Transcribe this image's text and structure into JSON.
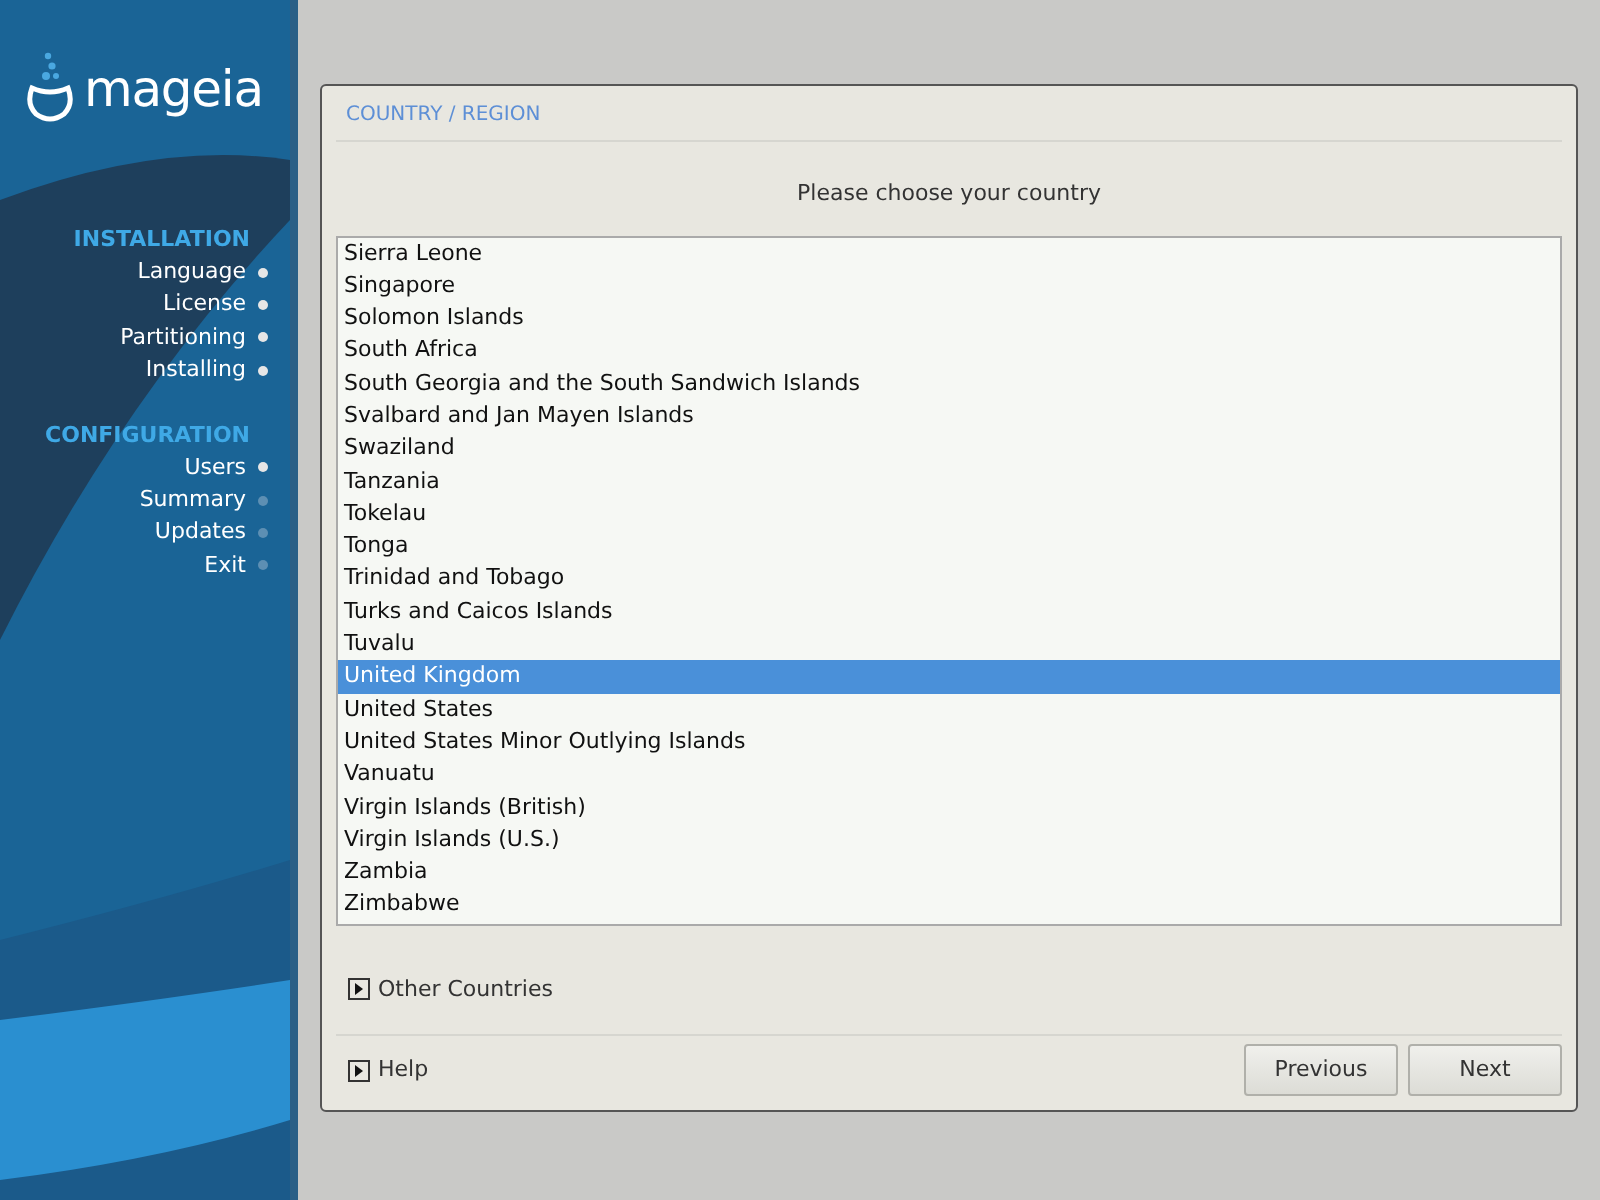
{
  "sidebar": {
    "logo": "mageia",
    "sections": [
      {
        "title": "INSTALLATION",
        "steps": [
          {
            "label": "Language",
            "done": true
          },
          {
            "label": "License",
            "done": true
          },
          {
            "label": "Partitioning",
            "done": true
          },
          {
            "label": "Installing",
            "done": true
          }
        ]
      },
      {
        "title": "CONFIGURATION",
        "steps": [
          {
            "label": "Users",
            "done": true
          },
          {
            "label": "Summary",
            "done": false
          },
          {
            "label": "Updates",
            "done": false
          },
          {
            "label": "Exit",
            "done": false
          }
        ]
      }
    ]
  },
  "dialog": {
    "title": "COUNTRY / REGION",
    "prompt": "Please choose your country",
    "countries": [
      {
        "label": "Sierra Leone",
        "selected": false
      },
      {
        "label": "Singapore",
        "selected": false
      },
      {
        "label": "Solomon Islands",
        "selected": false
      },
      {
        "label": "South Africa",
        "selected": false
      },
      {
        "label": "South Georgia and the South Sandwich Islands",
        "selected": false
      },
      {
        "label": "Svalbard and Jan Mayen Islands",
        "selected": false
      },
      {
        "label": "Swaziland",
        "selected": false
      },
      {
        "label": "Tanzania",
        "selected": false
      },
      {
        "label": "Tokelau",
        "selected": false
      },
      {
        "label": "Tonga",
        "selected": false
      },
      {
        "label": "Trinidad and Tobago",
        "selected": false
      },
      {
        "label": "Turks and Caicos Islands",
        "selected": false
      },
      {
        "label": "Tuvalu",
        "selected": false
      },
      {
        "label": "United Kingdom",
        "selected": true
      },
      {
        "label": "United States",
        "selected": false
      },
      {
        "label": "United States Minor Outlying Islands",
        "selected": false
      },
      {
        "label": "Vanuatu",
        "selected": false
      },
      {
        "label": "Virgin Islands (British)",
        "selected": false
      },
      {
        "label": "Virgin Islands (U.S.)",
        "selected": false
      },
      {
        "label": "Zambia",
        "selected": false
      },
      {
        "label": "Zimbabwe",
        "selected": false
      }
    ],
    "other_countries": {
      "label": "Other Countries",
      "expanded": false
    },
    "help": {
      "label": "Help",
      "expanded": false
    },
    "buttons": [
      "Previous",
      "Next"
    ]
  }
}
